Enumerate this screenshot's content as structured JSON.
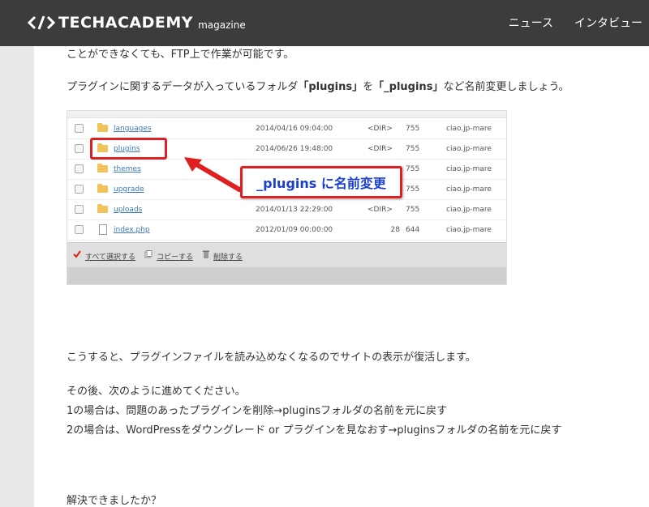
{
  "header": {
    "logo_text": "TECHACADEMY",
    "logo_sub": "magazine",
    "nav": [
      "ニュース",
      "インタビュー"
    ]
  },
  "article": {
    "partial_line": "ことができなくても、FTP上で作業が可能です。",
    "para1_a": "プラグインに関するデータが入っているフォルダ",
    "para1_b": "「plugins」",
    "para1_c": "を",
    "para1_d": "「_plugins」",
    "para1_e": "など名前変更しましょう。",
    "para2": "こうすると、プラグインファイルを読み込めなくなるのでサイトの表示が復活します。",
    "para3_line1": "その後、次のように進めてください。",
    "para3_line2": "1の場合は、問題のあったプラグインを削除→pluginsフォルダの名前を元に戻す",
    "para3_line3": "2の場合は、WordPressをダウングレード or プラグインを見なおす→pluginsフォルダの名前を元に戻す",
    "para4": "解決できましたか？"
  },
  "screenshot": {
    "rows": [
      {
        "name": "languages",
        "date": "2014/04/16 09:04:00",
        "dir": "<DIR>",
        "size": "",
        "perm": "755",
        "owner": "ciao.jp-mare",
        "type": "folder"
      },
      {
        "name": "plugins",
        "date": "2014/06/26 19:48:00",
        "dir": "<DIR>",
        "size": "",
        "perm": "755",
        "owner": "ciao.jp-mare",
        "type": "folder"
      },
      {
        "name": "themes",
        "date": "",
        "dir": "",
        "size": "",
        "perm": "755",
        "owner": "ciao.jp-mare",
        "type": "folder"
      },
      {
        "name": "upgrade",
        "date": "",
        "dir": "",
        "size": "",
        "perm": "755",
        "owner": "ciao.jp-mare",
        "type": "folder"
      },
      {
        "name": "uploads",
        "date": "2014/01/13 22:29:00",
        "dir": "<DIR>",
        "size": "",
        "perm": "755",
        "owner": "ciao.jp-mare",
        "type": "folder"
      },
      {
        "name": "index.php",
        "date": "2012/01/09 00:00:00",
        "dir": "",
        "size": "28",
        "perm": "644",
        "owner": "ciao.jp-mare",
        "type": "file"
      }
    ],
    "actions": {
      "select_all": "すべて選択する",
      "copy": "コピーする",
      "delete": "削除する"
    },
    "callout": "_plugins に名前変更"
  },
  "colors": {
    "header_bg": "#3c3c3c",
    "highlight": "#e02020",
    "callout_text": "#1b3fd0"
  }
}
